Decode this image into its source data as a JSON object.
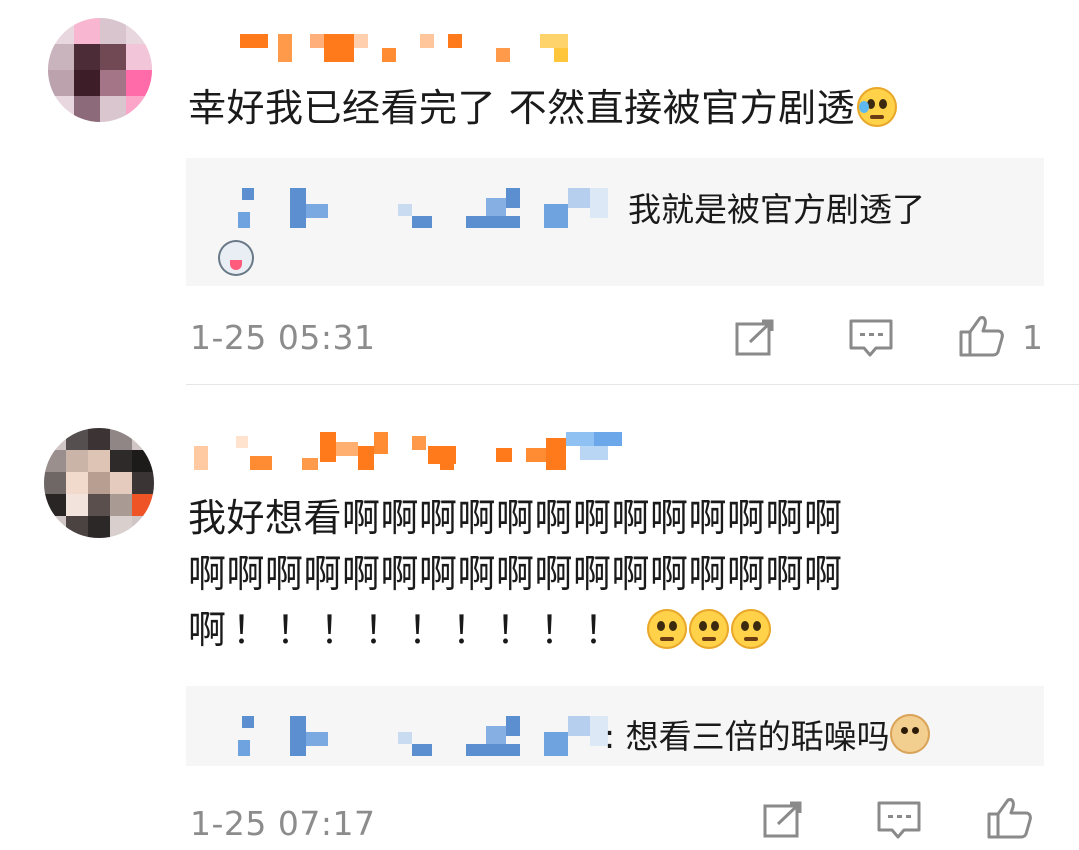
{
  "comments": [
    {
      "text_lines": [
        "幸好我已经看完了 不然直接被官方剧透"
      ],
      "emoji": "laughing-tears-emoji",
      "reply": {
        "text": "我就是被官方剧透了",
        "emoji": "husky-emoji"
      },
      "timestamp": "1-25 05:31",
      "like_count": "1"
    },
    {
      "text_lines": [
        "我好想看啊啊啊啊啊啊啊啊啊啊啊啊啊",
        "啊啊啊啊啊啊啊啊啊啊啊啊啊啊啊啊啊",
        "啊！！！！！！！！！"
      ],
      "emojis": [
        "pleading-emoji",
        "pleading-emoji",
        "pleading-emoji"
      ],
      "reply": {
        "text": ": 想看三倍的聒噪吗",
        "emoji": "doge-emoji"
      },
      "timestamp": "1-25 07:17",
      "like_count": ""
    }
  ],
  "colors": {
    "meta_text": "#8c8c8c",
    "reply_bg": "#f6f6f6",
    "icon": "#8a8a8a",
    "name_orange": "#ff7a1a",
    "name_blue": "#5b8fd0"
  }
}
